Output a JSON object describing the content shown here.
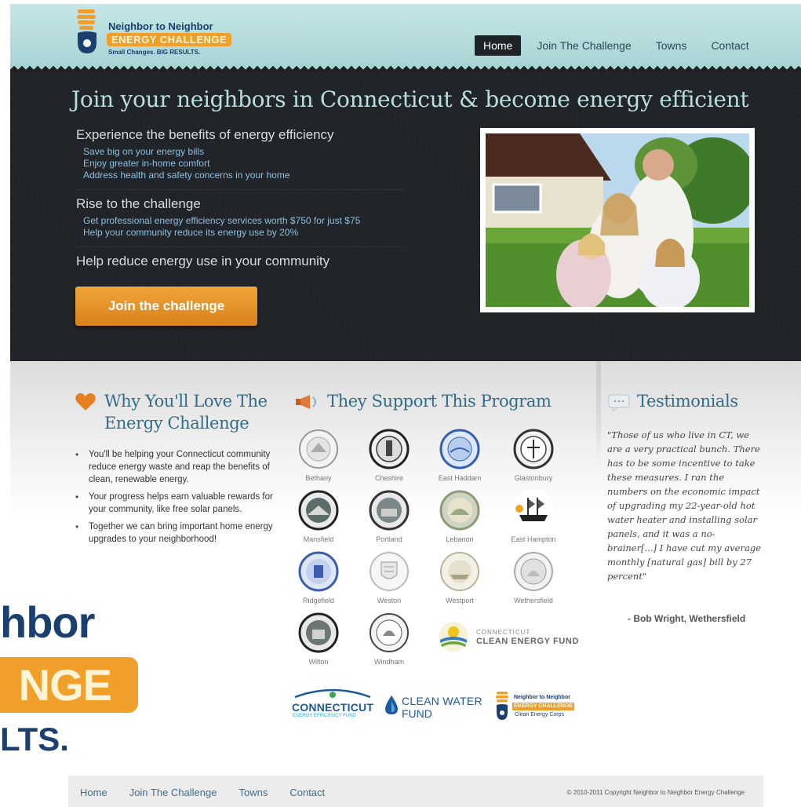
{
  "header": {
    "logo_line1": "Neighbor to Neighbor",
    "logo_line2": "ENERGY CHALLENGE",
    "logo_line3": "Small Changes. BIG RESULTS.",
    "nav": [
      "Home",
      "Join The Challenge",
      "Towns",
      "Contact"
    ],
    "active_nav": "Home"
  },
  "hero": {
    "title": "Join your neighbors in Connecticut & become energy efficient",
    "blocks": [
      {
        "heading": "Experience the benefits of energy efficiency",
        "bullets": [
          "Save big on your energy bills",
          "Enjoy greater in-home comfort",
          "Address health and safety concerns in your home"
        ]
      },
      {
        "heading": "Rise to the challenge",
        "bullets": [
          "Get professional energy efficiency services worth $750 for just $75",
          "Help your community reduce its energy use by 20%"
        ]
      },
      {
        "heading": "Help reduce energy use in your community",
        "bullets": []
      }
    ],
    "cta_label": "Join the challenge"
  },
  "why": {
    "title": "Why You'll Love The Energy Challenge",
    "items": [
      "You'll be helping your Connecticut community reduce energy waste and reap the benefits of clean, renewable energy.",
      "Your progress helps earn valuable rewards for your community, like free solar panels.",
      "Together we can bring important home energy upgrades to your neighborhood!"
    ]
  },
  "support": {
    "title": "They Support This Program",
    "towns": [
      "Bethany",
      "Cheshire",
      "East Haddam",
      "Glastonbury",
      "Mansfield",
      "Portland",
      "Lebanon",
      "East Hampton",
      "Ridgefield",
      "Weston",
      "Westport",
      "Wethersfield",
      "Wilton",
      "Windham"
    ],
    "clean_energy_fund_line1": "CONNECTICUT",
    "clean_energy_fund_line2": "CLEAN ENERGY FUND",
    "sponsor_ct_line1": "CONNECTICUT",
    "sponsor_ct_line2": "ENERGY EFFICIENCY FUND",
    "sponsor_cw_line1": "CLEAN WATER",
    "sponsor_cw_line2": "FUND",
    "sponsor_nn_line1": "Neighbor to Neighbor",
    "sponsor_nn_line2": "ENERGY CHALLENGE",
    "sponsor_nn_line3": "Clean Energy Corps"
  },
  "testimonials": {
    "title": "Testimonials",
    "quote": "\"Those of us who live in CT, we are a very practical bunch. There has to be some incentive to take these measures. I ran the numbers on the economic impact of upgrading my 22-year-old hot water heater and installing solar panels, and it was a no-brainer[...] I have cut my average monthly [natural gas] bill by 27 percent\"",
    "author": "- Bob Wright, Wethersfield"
  },
  "zoom_logo": {
    "line1": "hbor",
    "line2": "NGE",
    "line3": "LTS."
  },
  "footer": {
    "links": [
      "Home",
      "Join The Challenge",
      "Towns",
      "Contact"
    ],
    "copyright": "© 2010-2011 Copyright Neighbor to Neighbor Energy Challenge"
  },
  "colors": {
    "header_teal": "#b6dcdc",
    "hero_dark": "#212428",
    "accent_orange": "#f0a02a",
    "title_blue": "#2e6e8a",
    "brand_navy": "#1b3f6e"
  }
}
